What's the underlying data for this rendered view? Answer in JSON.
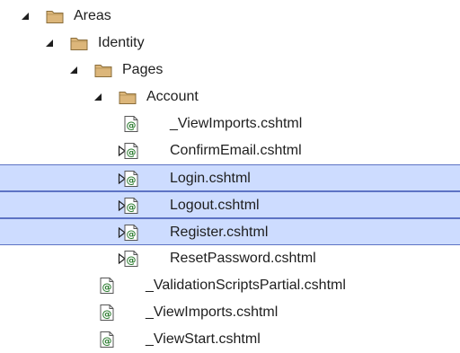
{
  "solution_explorer": {
    "nodes": [
      {
        "label": "Areas",
        "type": "folder",
        "state": "expanded",
        "depth": 0,
        "selected": false,
        "icon": "folder-icon"
      },
      {
        "label": "Identity",
        "type": "folder",
        "state": "expanded",
        "depth": 1,
        "selected": false,
        "icon": "folder-icon"
      },
      {
        "label": "Pages",
        "type": "folder",
        "state": "expanded",
        "depth": 2,
        "selected": false,
        "icon": "folder-icon"
      },
      {
        "label": "Account",
        "type": "folder",
        "state": "expanded",
        "depth": 3,
        "selected": false,
        "icon": "folder-icon"
      },
      {
        "label": "_ViewImports.cshtml",
        "type": "razor-file",
        "state": "leaf",
        "depth": 4,
        "selected": false,
        "icon": "razor-file-icon"
      },
      {
        "label": "ConfirmEmail.cshtml",
        "type": "razor-file",
        "state": "collapsed",
        "depth": 4,
        "selected": false,
        "icon": "razor-file-icon"
      },
      {
        "label": "Login.cshtml",
        "type": "razor-file",
        "state": "collapsed",
        "depth": 4,
        "selected": true,
        "icon": "razor-file-icon"
      },
      {
        "label": "Logout.cshtml",
        "type": "razor-file",
        "state": "collapsed",
        "depth": 4,
        "selected": true,
        "icon": "razor-file-icon"
      },
      {
        "label": "Register.cshtml",
        "type": "razor-file",
        "state": "collapsed",
        "depth": 4,
        "selected": true,
        "icon": "razor-file-icon"
      },
      {
        "label": "ResetPassword.cshtml",
        "type": "razor-file",
        "state": "collapsed",
        "depth": 4,
        "selected": false,
        "icon": "razor-file-icon"
      },
      {
        "label": "_ValidationScriptsPartial.cshtml",
        "type": "razor-file",
        "state": "leaf",
        "depth": 3,
        "selected": false,
        "icon": "razor-file-icon"
      },
      {
        "label": "_ViewImports.cshtml",
        "type": "razor-file",
        "state": "leaf",
        "depth": 3,
        "selected": false,
        "icon": "razor-file-icon"
      },
      {
        "label": "_ViewStart.cshtml",
        "type": "razor-file",
        "state": "leaf",
        "depth": 3,
        "selected": false,
        "icon": "razor-file-icon"
      }
    ]
  },
  "colors": {
    "selection_fill": "#cddcff",
    "selection_border": "#5d73c4",
    "folder": "#dcb67a",
    "razor_file": "#2e7d32",
    "text": "#1e1e1e"
  }
}
